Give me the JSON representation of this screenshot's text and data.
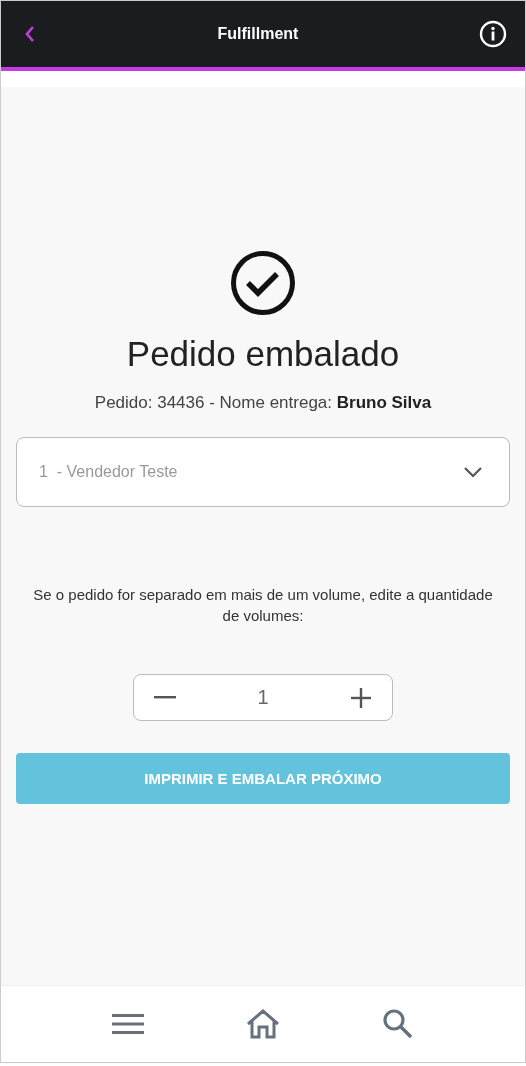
{
  "header": {
    "title": "Fulfillment"
  },
  "confirmation": {
    "title": "Pedido embalado",
    "details": "Pedido: 34436 - Nome entrega: **Bruno Silva**"
  },
  "seller_select": {
    "value": "1  - Vendedor Teste"
  },
  "volumes": {
    "instruction": "Se o pedido for separado em mais de um volume, edite a quantidade de volumes:",
    "quantity": "1"
  },
  "primary_button": {
    "label": "IMPRIMIR E EMBALAR PRÓXIMO"
  },
  "bottom_nav": [
    {
      "kind": "menu"
    },
    {
      "kind": "home"
    },
    {
      "kind": "search"
    }
  ]
}
